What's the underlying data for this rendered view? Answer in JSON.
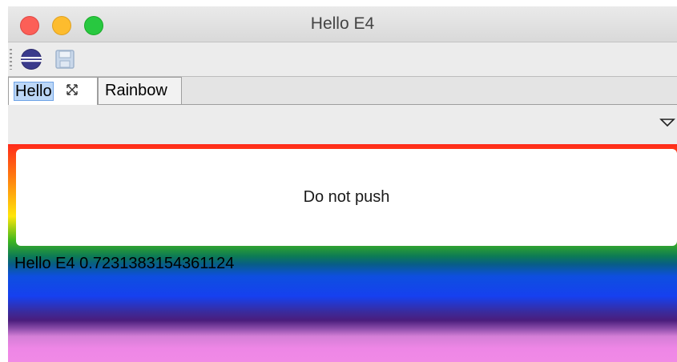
{
  "window": {
    "title": "Hello E4"
  },
  "toolbar": {
    "items": [
      {
        "icon": "eclipse-icon"
      },
      {
        "icon": "save-icon"
      }
    ]
  },
  "tabs": [
    {
      "label": "Hello",
      "active": true,
      "closable": true
    },
    {
      "label": "Rainbow",
      "active": false,
      "closable": false
    }
  ],
  "content": {
    "button_label": "Do not push",
    "hello_text": "Hello E4 0.7231383154361124"
  }
}
